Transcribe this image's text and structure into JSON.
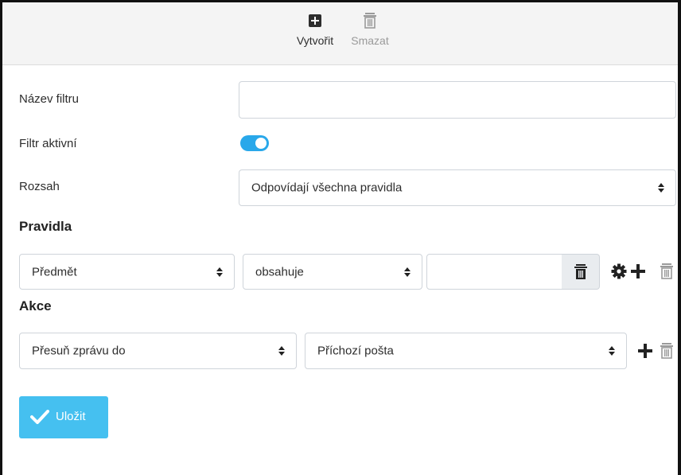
{
  "toolbar": {
    "create_label": "Vytvořit",
    "delete_label": "Smazat",
    "create_icon": "plus-square-icon",
    "delete_icon": "trash-icon"
  },
  "form": {
    "name_label": "Název filtru",
    "name_value": "",
    "active_label": "Filtr aktivní",
    "active_value": true,
    "scope_label": "Rozsah",
    "scope_value": "Odpovídají všechna pravidla"
  },
  "rules": {
    "heading": "Pravidla",
    "items": [
      {
        "field": "Předmět",
        "operator": "obsahuje",
        "value": ""
      }
    ]
  },
  "actions": {
    "heading": "Akce",
    "items": [
      {
        "action": "Přesuň zprávu do",
        "target": "Příchozí pošta"
      }
    ]
  },
  "save_label": "Uložit",
  "colors": {
    "accent": "#29a8ea",
    "save_button": "#45c0f0",
    "toolbar_bg": "#f4f4f4"
  }
}
